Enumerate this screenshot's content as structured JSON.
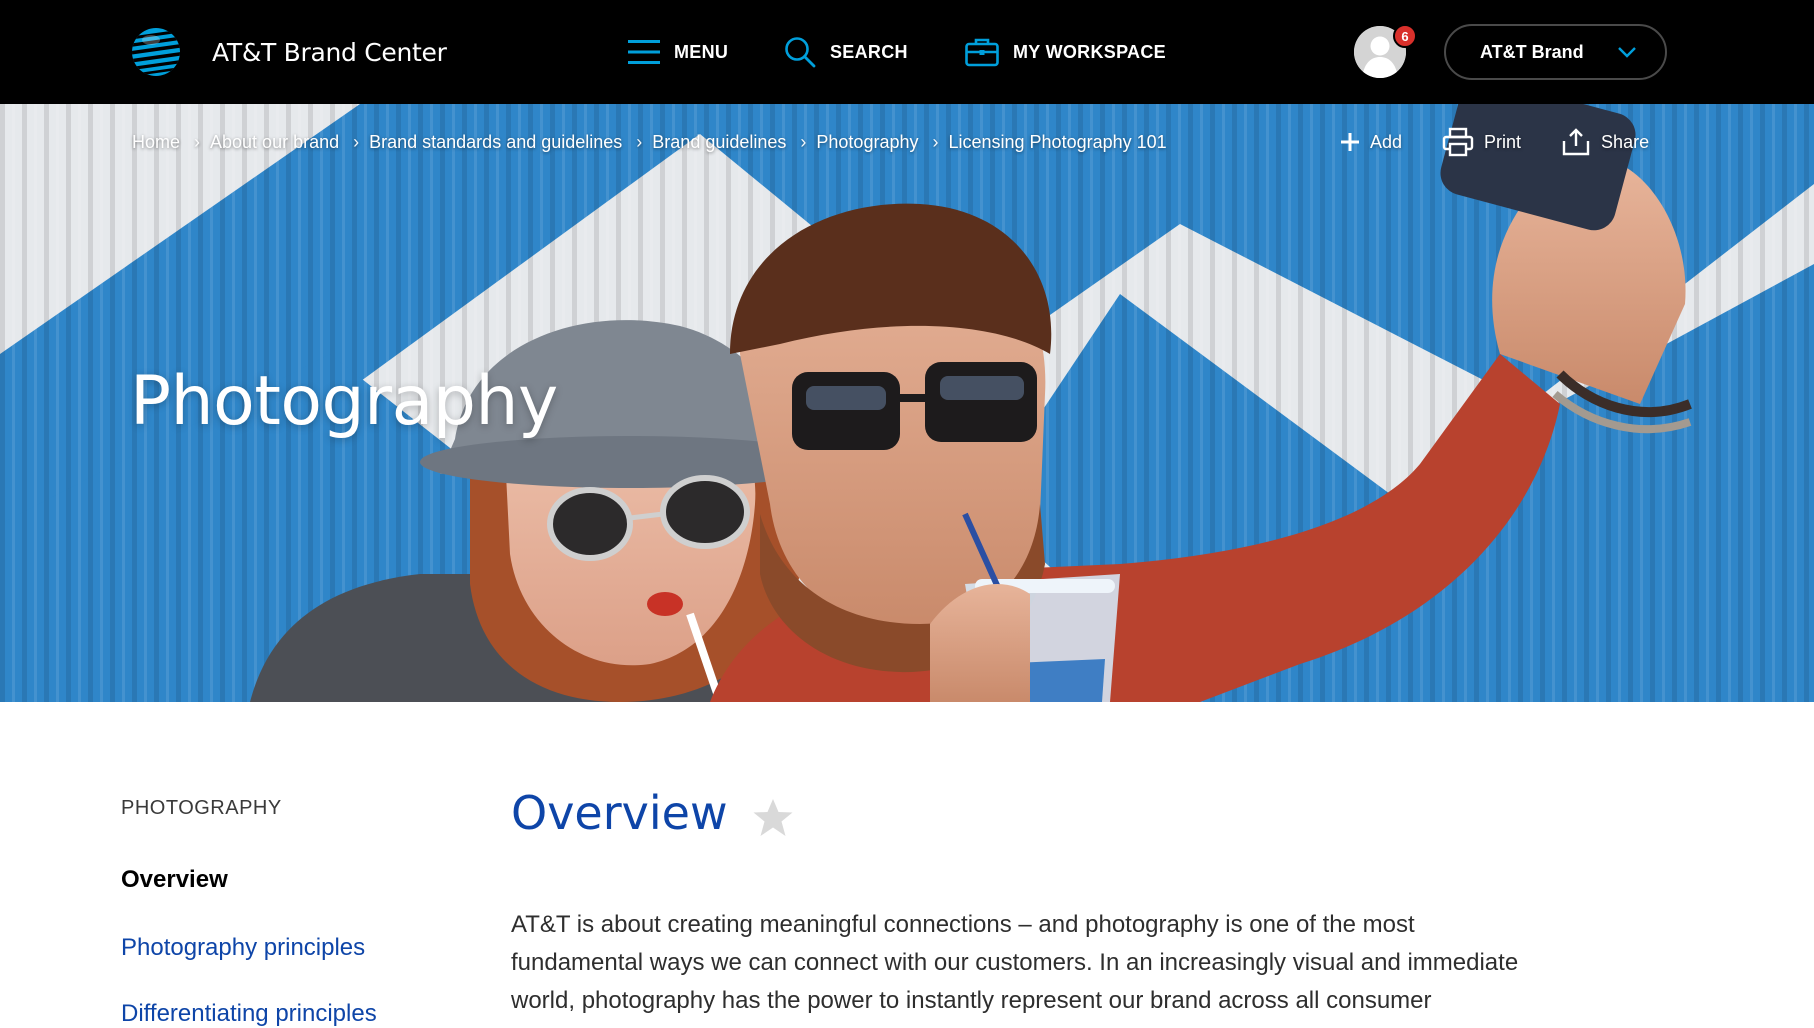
{
  "header": {
    "brand_name": "AT&T Brand Center",
    "nav": {
      "menu_label": "MENU",
      "search_label": "SEARCH",
      "workspace_label": "MY WORKSPACE"
    },
    "notification_count": "6",
    "brand_selector": {
      "selected": "AT&T Brand"
    },
    "icons": [
      "att-globe-icon",
      "menu-icon",
      "search-icon",
      "briefcase-icon",
      "user-avatar-icon",
      "chevron-down-icon"
    ]
  },
  "hero": {
    "breadcrumb": [
      {
        "label": "Home"
      },
      {
        "label": "About our brand"
      },
      {
        "label": "Brand standards and guidelines"
      },
      {
        "label": "Brand guidelines"
      },
      {
        "label": "Photography"
      },
      {
        "label": "Licensing Photography 101"
      }
    ],
    "actions": {
      "add_label": "Add",
      "print_label": "Print",
      "share_label": "Share"
    },
    "title": "Photography"
  },
  "sidebar": {
    "heading": "PHOTOGRAPHY",
    "items": [
      {
        "label": "Overview",
        "active": true
      },
      {
        "label": "Photography principles",
        "active": false
      },
      {
        "label": "Differentiating principles",
        "active": false
      }
    ]
  },
  "main": {
    "title": "Overview",
    "body_lines": [
      "AT&T is about creating meaningful connections – and photography is one of the most",
      "fundamental ways we can connect with our customers. In an increasingly visual and immediate",
      "world, photography has the power to instantly represent our brand across all consumer"
    ]
  },
  "colors": {
    "header_bg": "#000000",
    "accent_blue": "#009fdb",
    "link_blue": "#0e45a8",
    "badge_red": "#d9302b",
    "hero_stripe_blue": "#2f86c9"
  }
}
